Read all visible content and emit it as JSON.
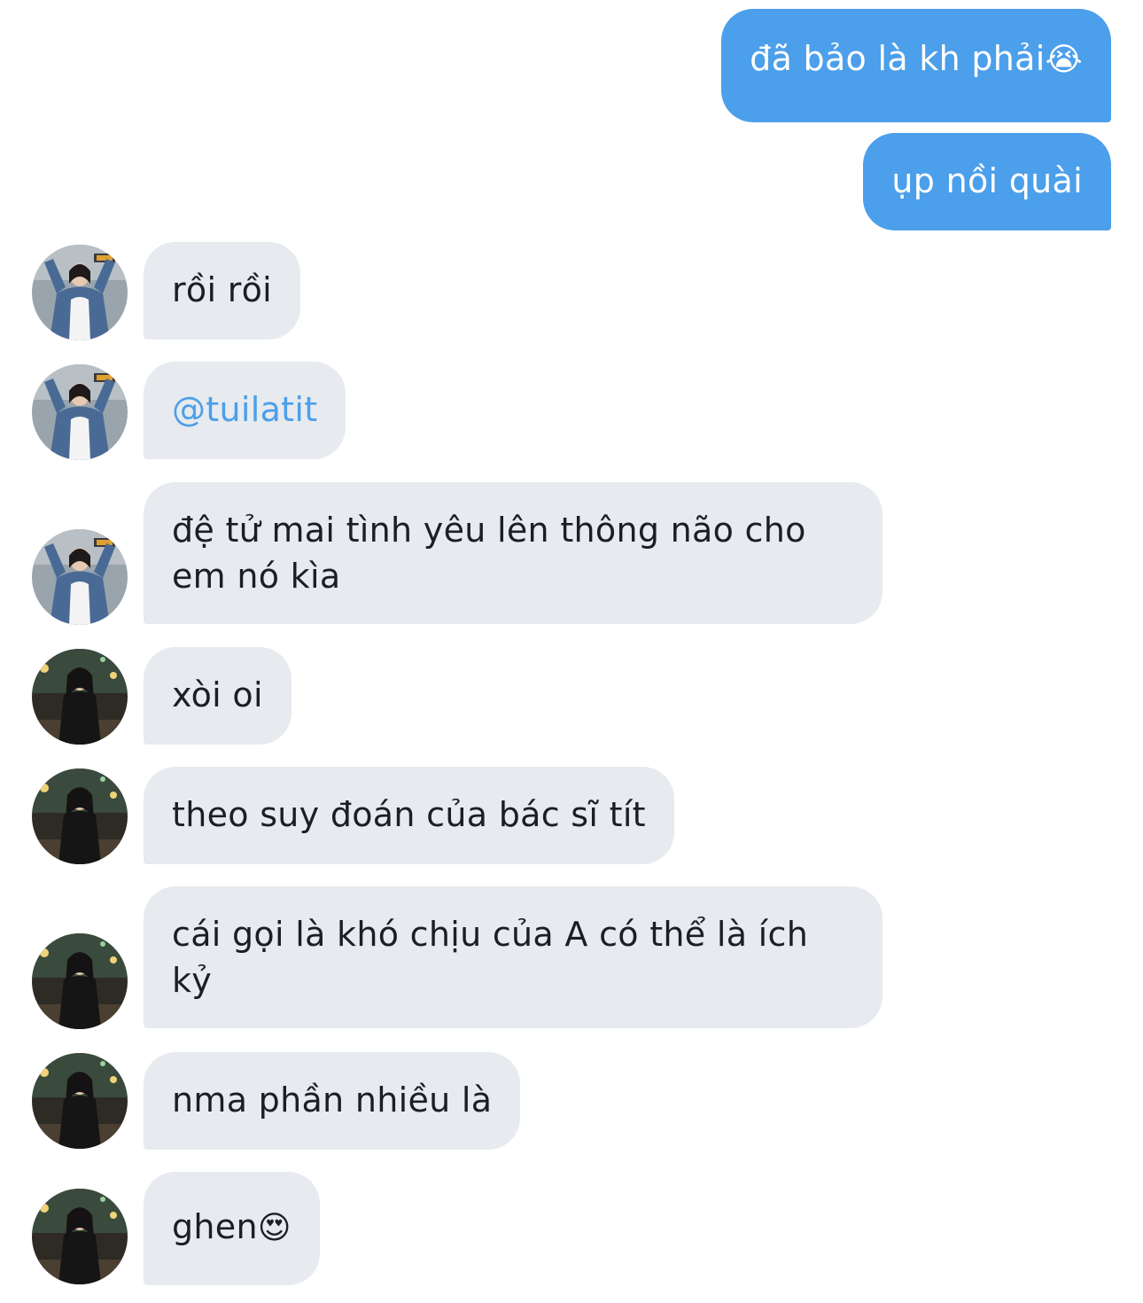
{
  "messages": {
    "outgoing": [
      {
        "text": "đã bảo là kh phải",
        "emoji": "😭"
      },
      {
        "text": "ụp nồi quài"
      }
    ],
    "incoming": [
      {
        "sender": "user_a",
        "text": "rồi rồi"
      },
      {
        "sender": "user_a",
        "text": "@tuilatit",
        "is_mention": true
      },
      {
        "sender": "user_a",
        "text": "đệ tử mai tình yêu lên thông não cho em nó kìa"
      },
      {
        "sender": "user_b",
        "text": "xòi oi"
      },
      {
        "sender": "user_b",
        "text": "theo suy đoán của bác sĩ tít"
      },
      {
        "sender": "user_b",
        "text": "cái gọi là khó chịu của A có thể là ích kỷ"
      },
      {
        "sender": "user_b",
        "text": "nma phần nhiều là"
      },
      {
        "sender": "user_b",
        "text": "ghen",
        "emoji": "😍"
      }
    ]
  },
  "colors": {
    "outgoing_bubble": "#4c9fea",
    "incoming_bubble": "#e7eaee",
    "mention": "#4c9fea",
    "text_dark": "#1b1f24"
  },
  "icons": {
    "user_a_avatar": "avatar-photo-denim-jacket",
    "user_b_avatar": "avatar-photo-night-street"
  }
}
